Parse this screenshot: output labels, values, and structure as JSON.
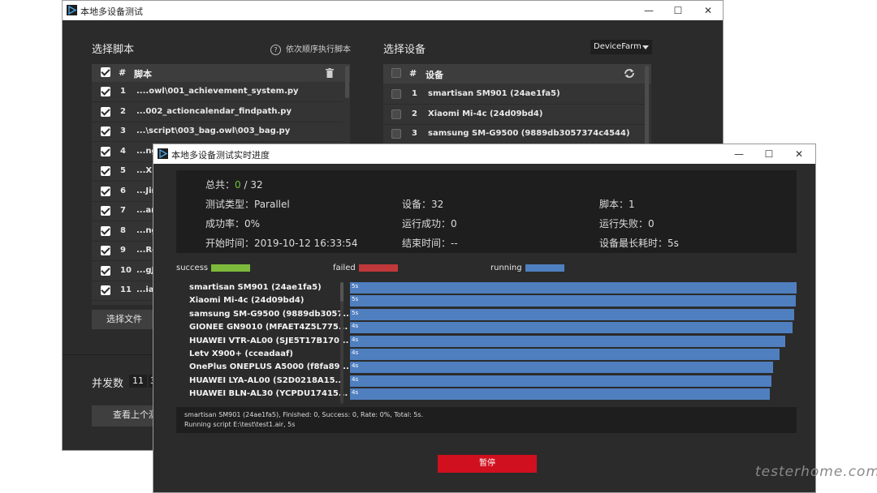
{
  "back_window": {
    "title": "本地多设备测试",
    "controls": {
      "minimize": "—",
      "maximize": "☐",
      "close": "✕"
    },
    "script_heading": "选择脚本",
    "sequential_hint": "依次顺序执行脚本",
    "script_list": {
      "header_num": "#",
      "header_name": "脚本",
      "rows": [
        {
          "num": "1",
          "name": "....owl\\001_achievement_system.py"
        },
        {
          "num": "2",
          "name": "...002_actioncalendar_findpath.py"
        },
        {
          "num": "3",
          "name": "...\\script\\003_bag.owl\\003_bag.py"
        },
        {
          "num": "4",
          "name": "...ng"
        },
        {
          "num": "5",
          "name": "...Xu"
        },
        {
          "num": "6",
          "name": "...Jin"
        },
        {
          "num": "7",
          "name": "...an"
        },
        {
          "num": "8",
          "name": "...ng"
        },
        {
          "num": "9",
          "name": "...Re"
        },
        {
          "num": "10",
          "name": "...gJ"
        },
        {
          "num": "11",
          "name": "...iar"
        }
      ]
    },
    "select_file_button": "选择文件",
    "device_heading": "选择设备",
    "device_source": "DeviceFarm",
    "device_list": {
      "header_num": "#",
      "header_name": "设备",
      "rows": [
        {
          "num": "1",
          "name": "smartisan SM901 (24ae1fa5)"
        },
        {
          "num": "2",
          "name": "Xiaomi Mi-4c (24d09bd4)"
        },
        {
          "num": "3",
          "name": "samsung SM-G9500 (9889db3057374c4544)"
        }
      ]
    },
    "concurrency_label": "并发数",
    "concurrency_value": "11",
    "concurrency_extra": "3",
    "view_last_button": "查看上个测"
  },
  "front_window": {
    "title": "本地多设备测试实时进度",
    "controls": {
      "minimize": "—",
      "maximize": "☐",
      "close": "✕"
    },
    "summary": {
      "total_label": "总共：",
      "total_done": "0",
      "total_sep": " / ",
      "total_all": "32",
      "test_type": "测试类型：Parallel",
      "devices": "设备：32",
      "scripts": "脚本：1",
      "success_rate": "成功率：0%",
      "run_success": "运行成功：0",
      "run_failed": "运行失败：0",
      "start_time": "开始时间：2019-10-12 16:33:54",
      "end_time": "结束时间：--",
      "max_device_time": "设备最长耗时：5s"
    },
    "legend": {
      "success": "success",
      "failed": "failed",
      "running": "running",
      "success_color": "#7dba3c",
      "failed_color": "#c0383a",
      "running_color": "#4f7fbf"
    },
    "devices": [
      {
        "name": "smartisan SM901 (24ae1fa5)",
        "time": "5s",
        "progress": 1.0
      },
      {
        "name": "Xiaomi Mi-4c (24d09bd4)",
        "time": "5s",
        "progress": 0.998
      },
      {
        "name": "samsung SM-G9500 (9889db3057...",
        "time": "5s",
        "progress": 0.994
      },
      {
        "name": "GIONEE GN9010 (MFAET4Z5L775...",
        "time": "4s",
        "progress": 0.99
      },
      {
        "name": "HUAWEI VTR-AL00 (SJE5T17B170...",
        "time": "4s",
        "progress": 0.974
      },
      {
        "name": "Letv X900+ (cceadaaf)",
        "time": "4s",
        "progress": 0.961
      },
      {
        "name": "OnePlus ONEPLUS A5000 (f8fa89...",
        "time": "4s",
        "progress": 0.948
      },
      {
        "name": "HUAWEI LYA-AL00 (S2D0218A15...",
        "time": "4s",
        "progress": 0.944
      },
      {
        "name": "HUAWEI BLN-AL30 (YCPDU17415...",
        "time": "4s",
        "progress": 0.94
      }
    ],
    "log_line1": "smartisan SM901 (24ae1fa5),  Finished: 0,  Success: 0,  Rate: 0%,  Total: 5s.",
    "log_line2": "Running script E:\\test\\test1.air, 5s",
    "pause_button": "暂停"
  },
  "watermark": "testerhome.com"
}
